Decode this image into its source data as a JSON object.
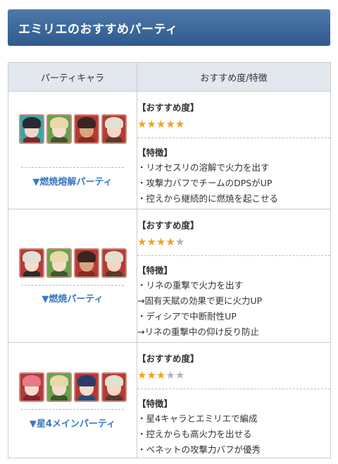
{
  "header": {
    "title": "エミリエのおすすめパーティ"
  },
  "table": {
    "col_party": "パーティキャラ",
    "col_recommend": "おすすめ度/特徴"
  },
  "parties": [
    {
      "name": "▼燃焼熔解パーティ",
      "stars": 5,
      "stars_max": 5,
      "recommend_label": "【おすすめ度】",
      "feature_label": "【特徴】",
      "features": [
        "・リオセスリの溶解で火力を出す",
        "・攻撃力バフでチームのDPSがUP",
        "・控えから継続的に燃焼を起こせる"
      ],
      "characters": [
        {
          "icon": "wriothesley-icon",
          "bg": "#3aa6a2",
          "hair": "#2a2a34",
          "skin": "#f2d6c4",
          "outfit": "#7b2630"
        },
        {
          "icon": "emilie-icon",
          "bg": "#6aa04a",
          "hair": "#e7d9a8",
          "skin": "#f3dccb",
          "outfit": "#3b5a2c"
        },
        {
          "icon": "xinyan-icon",
          "bg": "#b53a35",
          "hair": "#3a2520",
          "skin": "#d9a57e",
          "outfit": "#8a2a22"
        },
        {
          "icon": "bennett-icon",
          "bg": "#b53a35",
          "hair": "#e4e0d0",
          "skin": "#f2d7c2",
          "outfit": "#5a3a2a"
        }
      ]
    },
    {
      "name": "▼燃焼パーティ",
      "stars": 4,
      "stars_max": 5,
      "recommend_label": "【おすすめ度】",
      "feature_label": "【特徴】",
      "features": [
        "・リネの重撃で火力を出す",
        "→固有天賦の効果で更に火力UP",
        "・ディシアで中断耐性UP",
        "→リネの重撃中の仰け反り防止"
      ],
      "characters": [
        {
          "icon": "lyney-icon",
          "bg": "#b53a35",
          "hair": "#e2dfd6",
          "skin": "#f3dccb",
          "outfit": "#2a2a2a"
        },
        {
          "icon": "emilie-icon",
          "bg": "#6aa04a",
          "hair": "#e7d9a8",
          "skin": "#f3dccb",
          "outfit": "#3b5a2c"
        },
        {
          "icon": "dehya-icon",
          "bg": "#b53a35",
          "hair": "#3a2520",
          "skin": "#d9a57e",
          "outfit": "#8a2a22"
        },
        {
          "icon": "bennett-icon",
          "bg": "#b53a35",
          "hair": "#e4e0d0",
          "skin": "#f2d7c2",
          "outfit": "#5a3a2a"
        }
      ]
    },
    {
      "name": "▼星4メインパーティ",
      "stars": 3,
      "stars_max": 5,
      "recommend_label": "【おすすめ度】",
      "feature_label": "【特徴】",
      "features": [
        "・星4キャラとエミリエで編成",
        "・控えからも高火力を出せる",
        "・ベネットの攻撃力バフが優秀"
      ],
      "characters": [
        {
          "icon": "yanfei-icon",
          "bg": "#b53a35",
          "hair": "#e8788a",
          "skin": "#f6dccf",
          "outfit": "#8a2030"
        },
        {
          "icon": "emilie-icon",
          "bg": "#6aa04a",
          "hair": "#e7d9a8",
          "skin": "#f3dccb",
          "outfit": "#3b5a2c"
        },
        {
          "icon": "xingqiu-icon",
          "bg": "#b53a35",
          "hair": "#2a3d6a",
          "skin": "#f3dccb",
          "outfit": "#2d4a7a"
        },
        {
          "icon": "bennett-icon",
          "bg": "#b53a35",
          "hair": "#e4e0d0",
          "skin": "#f2d7c2",
          "outfit": "#5a3a2a"
        }
      ]
    }
  ]
}
